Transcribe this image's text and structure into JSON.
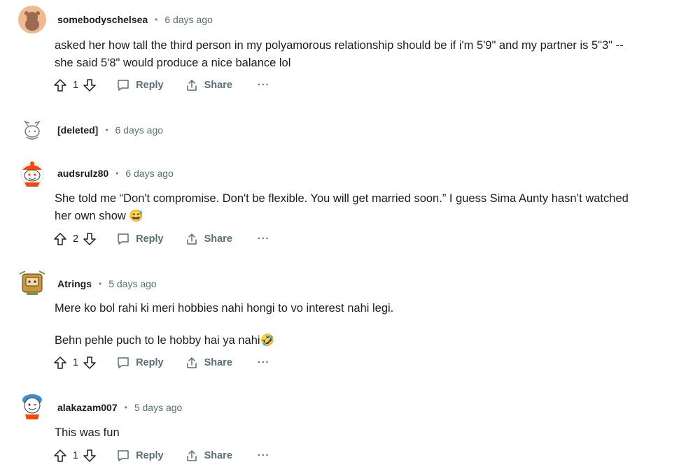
{
  "comments": [
    {
      "author": "somebodyschelsea",
      "time": "6 days ago",
      "lines": [
        "asked her how tall the third person in my polyamorous relationship should be if i'm 5'9\" and my partner is 5\"3\" --",
        "she said 5'8\" would produce a nice balance lol"
      ],
      "votes": "1"
    },
    {
      "author": "[deleted]",
      "time": "6 days ago"
    },
    {
      "author": "audsrulz80",
      "time": "6 days ago",
      "lines": [
        "She told me “Don't compromise. Don't be flexible. You will get married soon.” I guess Sima Aunty hasn’t watched",
        "her own show 😅"
      ],
      "votes": "2"
    },
    {
      "author": "Atrings",
      "time": "5 days ago",
      "paragraphs": [
        "Mere ko bol rahi ki meri hobbies nahi hongi to vo interest nahi legi.",
        "Behn pehle puch to le hobby hai ya nahi🤣"
      ],
      "votes": "1"
    },
    {
      "author": "alakazam007",
      "time": "5 days ago",
      "lines": [
        "This was fun"
      ],
      "votes": "1"
    }
  ],
  "actions": {
    "reply": "Reply",
    "share": "Share",
    "more": "···"
  },
  "colors": {
    "meta_gray": "#576f76",
    "avatar_orange": "#ff4500"
  }
}
